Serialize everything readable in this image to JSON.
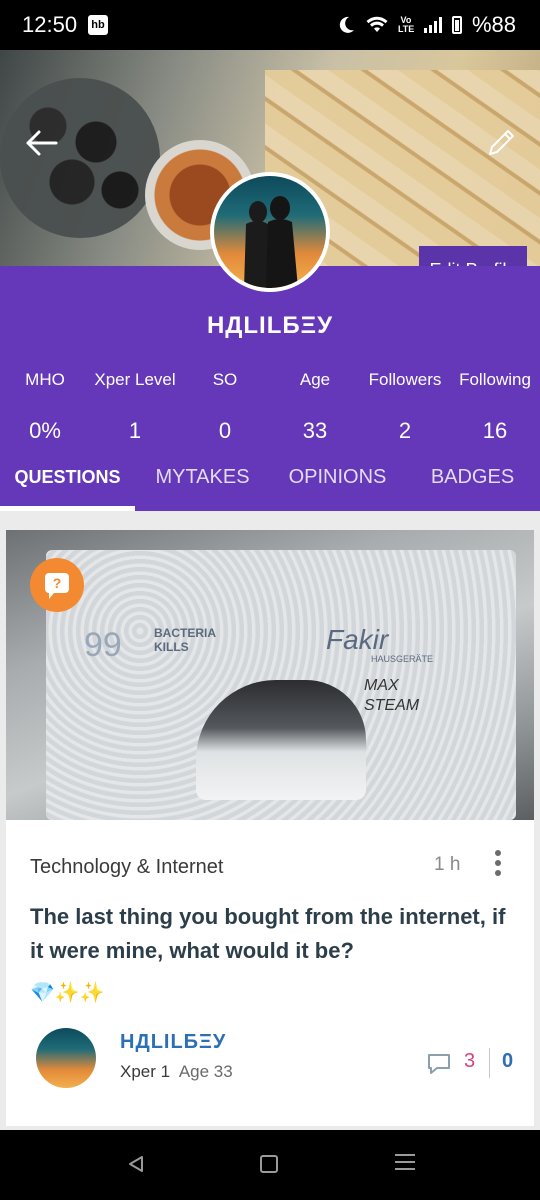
{
  "status_bar": {
    "time": "12:50",
    "app_badge": "hb",
    "volte": "Vo LTE",
    "battery": "%88"
  },
  "cover": {
    "edit_profile_label": "Edit Profile"
  },
  "profile": {
    "username": "НДLILБΞУ",
    "stats": [
      {
        "label": "MHO",
        "value": "0%"
      },
      {
        "label": "Xper Level",
        "value": "1"
      },
      {
        "label": "SO",
        "value": "0"
      },
      {
        "label": "Age",
        "value": "33"
      },
      {
        "label": "Followers",
        "value": "2"
      },
      {
        "label": "Following",
        "value": "16"
      }
    ]
  },
  "tabs": [
    {
      "label": "QUESTIONS",
      "active": true
    },
    {
      "label": "MYTAKES",
      "active": false
    },
    {
      "label": "OPINIONS",
      "active": false
    },
    {
      "label": "BADGES",
      "active": false
    }
  ],
  "post": {
    "badge": "?",
    "image": {
      "percent": "99",
      "bacteria_line1": "BACTERIA",
      "bacteria_line2": "KILLS",
      "brand": "Fakir",
      "brand_sub": "HAUSGERÄTE",
      "product_line1": "MAX",
      "product_line2": "STEAM"
    },
    "category": "Technology & Internet",
    "time": "1 h",
    "question": "The last thing you bought from the internet, if it were mine, what would it be?",
    "emojis": "💎✨✨",
    "author": {
      "name": "НДLILБΞУ",
      "xper": "Xper 1",
      "age": "Age 33"
    },
    "comments": "3",
    "shares": "0"
  },
  "colors": {
    "primary": "#6438b8",
    "accent_orange": "#f38a31",
    "link_blue": "#2d6fb5",
    "comment_pink": "#d9427a"
  }
}
